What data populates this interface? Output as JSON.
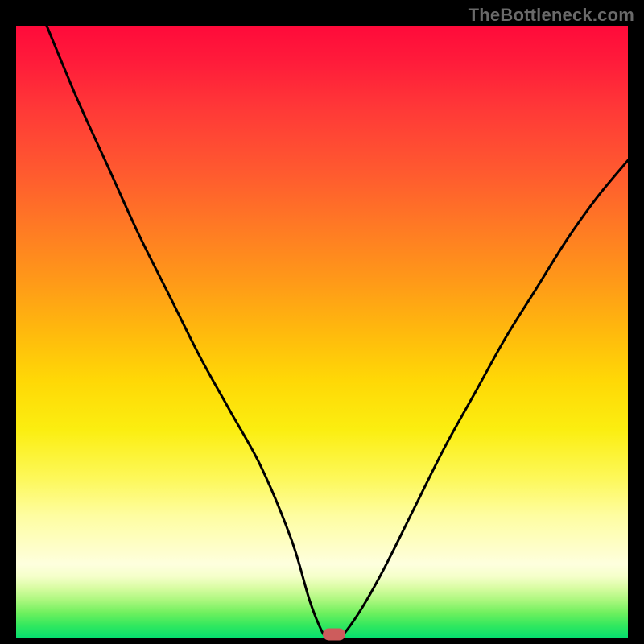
{
  "watermark": "TheBottleneck.com",
  "chart_data": {
    "type": "line",
    "title": "",
    "xlabel": "",
    "ylabel": "",
    "xlim": [
      0,
      100
    ],
    "ylim": [
      0,
      100
    ],
    "grid": false,
    "legend": false,
    "series": [
      {
        "name": "bottleneck-curve",
        "x": [
          5,
          10,
          15,
          20,
          25,
          30,
          35,
          40,
          45,
          48,
          50,
          51,
          52,
          53,
          56,
          60,
          65,
          70,
          75,
          80,
          85,
          90,
          95,
          100
        ],
        "values": [
          100,
          88,
          77,
          66,
          56,
          46,
          37,
          28,
          16,
          6,
          1,
          0,
          0,
          0,
          4,
          11,
          21,
          31,
          40,
          49,
          57,
          65,
          72,
          78
        ]
      }
    ],
    "marker": {
      "x": 52,
      "y": 0.5,
      "color": "#cd5c5c"
    },
    "gradient_stops": [
      {
        "pos": 0,
        "color": "#ff0a3a"
      },
      {
        "pos": 24,
        "color": "#ff5a2f"
      },
      {
        "pos": 50,
        "color": "#ffb90d"
      },
      {
        "pos": 74,
        "color": "#fdf85a"
      },
      {
        "pos": 88,
        "color": "#feffde"
      },
      {
        "pos": 100,
        "color": "#06df6e"
      }
    ]
  }
}
